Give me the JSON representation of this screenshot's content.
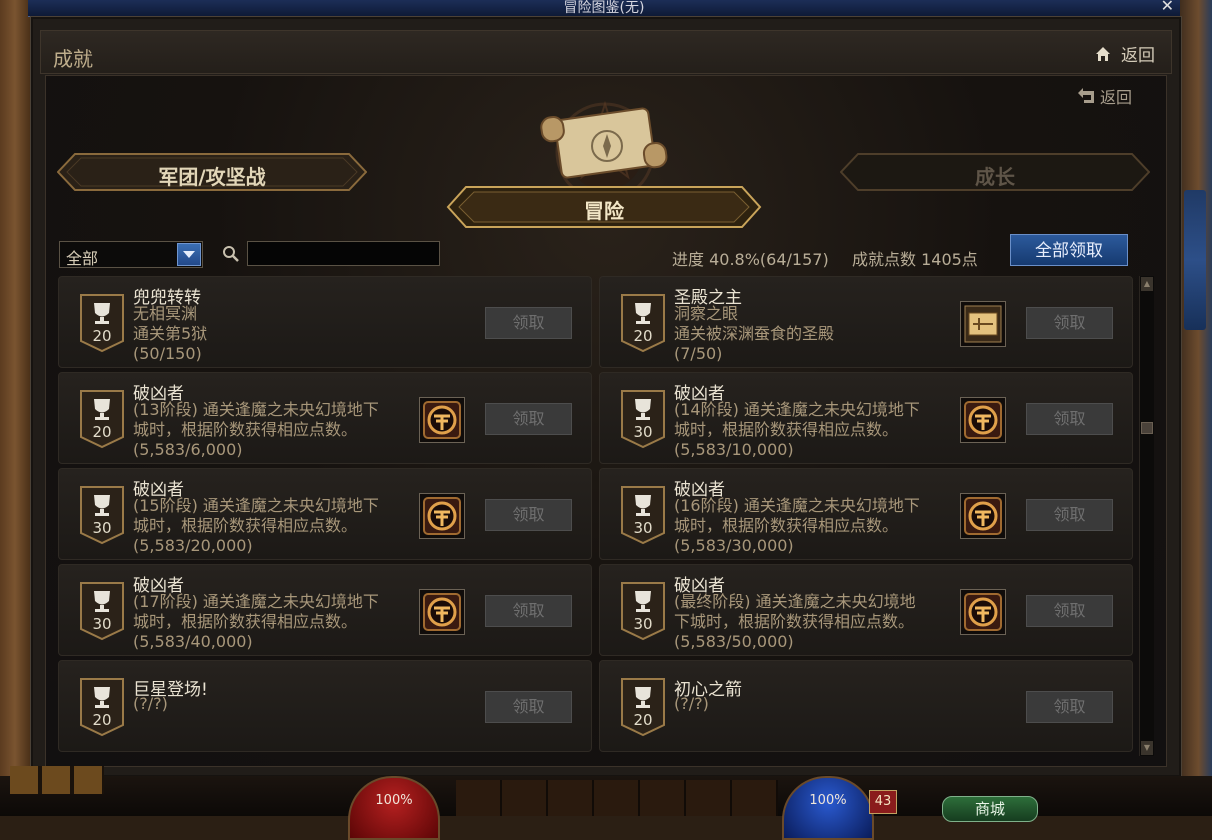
{
  "window": {
    "title": "冒险图鉴(无)",
    "close": "✕"
  },
  "header": {
    "title": "成就",
    "home_label": "返回"
  },
  "panel": {
    "back_label": "返回"
  },
  "tabs": {
    "left": "军团/攻坚战",
    "center": "冒险",
    "right": "成长"
  },
  "filter": {
    "selected": "全部",
    "search_placeholder": ""
  },
  "stats": {
    "progress_label": "进度 40.8%(64/157)",
    "points_label": "成就点数 1405点",
    "claim_all": "全部领取"
  },
  "achievements": [
    {
      "name": "兜兜转转",
      "points": "20",
      "lines": [
        "无相冥渊",
        "通关第5狱",
        "(50/150)"
      ],
      "reward": false,
      "claim": "领取"
    },
    {
      "name": "圣殿之主",
      "points": "20",
      "lines": [
        "洞察之眼",
        "通关被深渊蚕食的圣殿",
        "(7/50)"
      ],
      "reward": "map",
      "claim": "领取"
    },
    {
      "name": "破凶者",
      "points": "20",
      "lines": [
        "(13阶段) 通关逢魔之未央幻境地下",
        "城时，根据阶数获得相应点数。",
        "(5,583/6,000)"
      ],
      "reward": "emblem",
      "claim": "领取"
    },
    {
      "name": "破凶者",
      "points": "30",
      "lines": [
        "(14阶段) 通关逢魔之未央幻境地下",
        "城时，根据阶数获得相应点数。",
        "(5,583/10,000)"
      ],
      "reward": "emblem",
      "claim": "领取"
    },
    {
      "name": "破凶者",
      "points": "30",
      "lines": [
        "(15阶段) 通关逢魔之未央幻境地下",
        "城时，根据阶数获得相应点数。",
        "(5,583/20,000)"
      ],
      "reward": "emblem",
      "claim": "领取"
    },
    {
      "name": "破凶者",
      "points": "30",
      "lines": [
        "(16阶段) 通关逢魔之未央幻境地下",
        "城时，根据阶数获得相应点数。",
        "(5,583/30,000)"
      ],
      "reward": "emblem",
      "claim": "领取"
    },
    {
      "name": "破凶者",
      "points": "30",
      "lines": [
        "(17阶段) 通关逢魔之未央幻境地下",
        "城时，根据阶数获得相应点数。",
        "(5,583/40,000)"
      ],
      "reward": "emblem",
      "claim": "领取"
    },
    {
      "name": "破凶者",
      "points": "30",
      "lines": [
        "(最终阶段) 通关逢魔之未央幻境地",
        "下城时，根据阶数获得相应点数。",
        "(5,583/50,000)"
      ],
      "reward": "emblem",
      "claim": "领取"
    },
    {
      "name": "巨星登场!",
      "points": "20",
      "lines": [
        "(?/?)"
      ],
      "reward": false,
      "claim": "领取"
    },
    {
      "name": "初心之箭",
      "points": "20",
      "lines": [
        "(?/?)"
      ],
      "reward": false,
      "claim": "领取"
    }
  ],
  "hud": {
    "hp": "100%",
    "mp": "100%",
    "level": "43",
    "shop": "商城"
  },
  "colors": {
    "accent_blue": "#2c5a9c",
    "gold": "#c9a45a",
    "disabled": "#3a3a3a"
  }
}
